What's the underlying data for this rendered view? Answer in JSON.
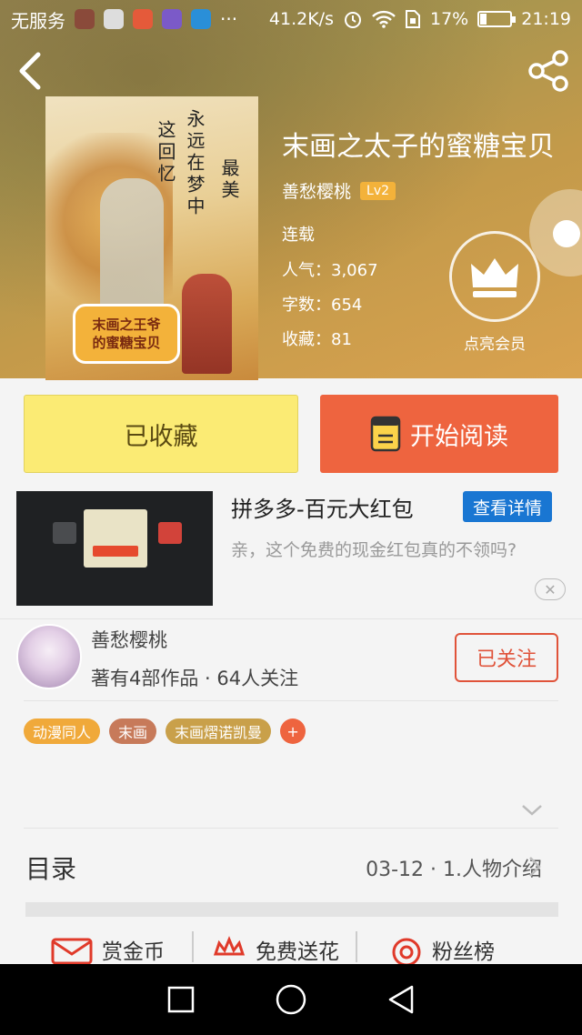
{
  "status_bar": {
    "carrier": "无服务",
    "more": "···",
    "speed": "41.2K/s",
    "battery": "17%",
    "time": "21:19"
  },
  "book": {
    "title": "末画之太子的蜜糖宝贝",
    "author": "善愁樱桃",
    "level": "Lv2",
    "status": "连载",
    "popularity": "人气：3,067",
    "word_count": "字数：654",
    "favorites": "收藏：81",
    "cover_text_1": "这回忆",
    "cover_text_2": "永远在梦中",
    "cover_text_3": "最美",
    "cover_label_line1": "末画之王爷",
    "cover_label_line2": "的蜜糖宝贝"
  },
  "vip": {
    "label": "点亮会员"
  },
  "actions": {
    "collect": "已收藏",
    "read": "开始阅读"
  },
  "ad": {
    "title": "拼多多-百元大红包",
    "detail_button": "查看详情",
    "description": "亲，这个免费的现金红包真的不领吗?"
  },
  "author_info": {
    "name": "善愁樱桃",
    "stats": "著有4部作品 · 64人关注",
    "follow_button": "已关注"
  },
  "tags": [
    {
      "label": "动漫同人",
      "color": "#f0a93a"
    },
    {
      "label": "末画",
      "color": "#c77a5a"
    },
    {
      "label": "末画熠诺凯曼",
      "color": "#c9a04a"
    }
  ],
  "tag_add": "+",
  "toc": {
    "label": "目录",
    "latest": "03-12 · 1.人物介绍"
  },
  "bottom_actions": [
    {
      "label": "赏金币",
      "icon": "envelope-icon"
    },
    {
      "label": "免费送花",
      "icon": "flower-icon"
    },
    {
      "label": "粉丝榜",
      "icon": "target-icon"
    }
  ],
  "colors": {
    "accent": "#ee643f",
    "collect_bg": "#fbeb74",
    "detail_blue": "#1976d2"
  }
}
